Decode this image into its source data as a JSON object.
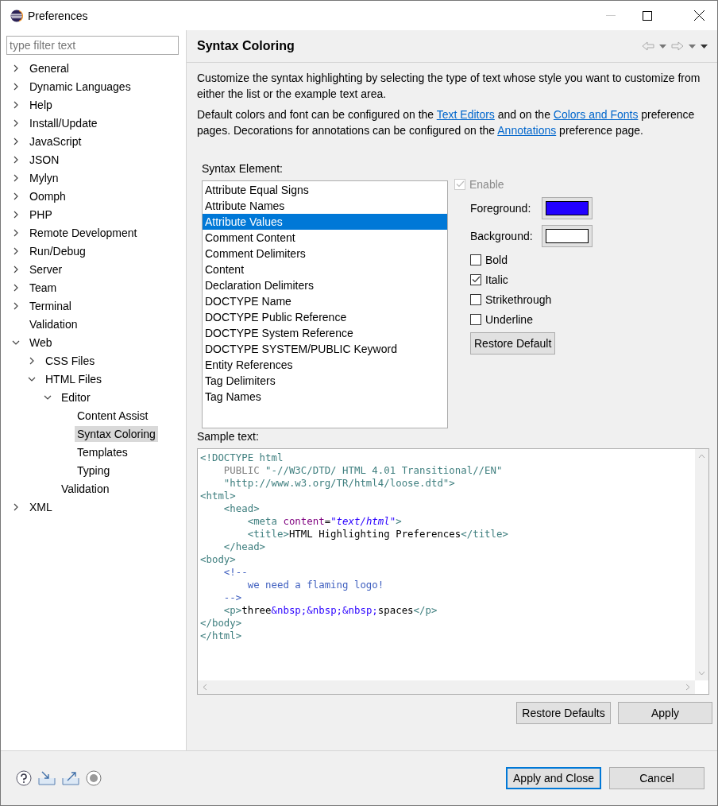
{
  "window": {
    "title": "Preferences"
  },
  "filter": {
    "placeholder": "type filter text"
  },
  "tree": [
    {
      "label": "General",
      "expanded": false,
      "selected": false
    },
    {
      "label": "Dynamic Languages",
      "expanded": false,
      "selected": false
    },
    {
      "label": "Help",
      "expanded": false,
      "selected": false
    },
    {
      "label": "Install/Update",
      "expanded": false,
      "selected": false
    },
    {
      "label": "JavaScript",
      "expanded": false,
      "selected": false
    },
    {
      "label": "JSON",
      "expanded": false,
      "selected": false
    },
    {
      "label": "Mylyn",
      "expanded": false,
      "selected": false
    },
    {
      "label": "Oomph",
      "expanded": false,
      "selected": false
    },
    {
      "label": "PHP",
      "expanded": false,
      "selected": false
    },
    {
      "label": "Remote Development",
      "expanded": false,
      "selected": false
    },
    {
      "label": "Run/Debug",
      "expanded": false,
      "selected": false
    },
    {
      "label": "Server",
      "expanded": false,
      "selected": false
    },
    {
      "label": "Team",
      "expanded": false,
      "selected": false
    },
    {
      "label": "Terminal",
      "expanded": false,
      "selected": false
    },
    {
      "label": "Validation",
      "kind": "leaf",
      "selected": false
    },
    {
      "label": "Web",
      "expanded": true,
      "selected": false,
      "children": [
        {
          "label": "CSS Files",
          "expanded": false,
          "selected": false
        },
        {
          "label": "HTML Files",
          "expanded": true,
          "selected": false,
          "children": [
            {
              "label": "Editor",
              "expanded": true,
              "selected": false,
              "children": [
                {
                  "label": "Content Assist",
                  "kind": "leaf",
                  "selected": false
                },
                {
                  "label": "Syntax Coloring",
                  "kind": "leaf",
                  "selected": true
                },
                {
                  "label": "Templates",
                  "kind": "leaf",
                  "selected": false
                },
                {
                  "label": "Typing",
                  "kind": "leaf",
                  "selected": false
                }
              ]
            },
            {
              "label": "Validation",
              "kind": "leaf",
              "selected": false
            }
          ]
        }
      ]
    },
    {
      "label": "XML",
      "expanded": false,
      "selected": false
    }
  ],
  "page": {
    "title": "Syntax Coloring",
    "description": "Customize the syntax highlighting by selecting the type of text whose style you want to customize from either the list or the example text area.",
    "note": [
      {
        "kind": "text",
        "text": "Default colors and font can be configured on the "
      },
      {
        "kind": "link",
        "text": "Text Editors"
      },
      {
        "kind": "text",
        "text": " and on the "
      },
      {
        "kind": "link",
        "text": "Colors and Fonts"
      },
      {
        "kind": "text",
        "text": " preference pages.  Decorations for annotations can be configured on the "
      },
      {
        "kind": "link",
        "text": "Annotations"
      },
      {
        "kind": "text",
        "text": " preference page."
      }
    ],
    "element_label": "Syntax Element:",
    "elements": [
      {
        "label": "Attribute Equal Signs",
        "selected": false
      },
      {
        "label": "Attribute Names",
        "selected": false
      },
      {
        "label": "Attribute Values",
        "selected": true
      },
      {
        "label": "Comment Content",
        "selected": false
      },
      {
        "label": "Comment Delimiters",
        "selected": false
      },
      {
        "label": "Content",
        "selected": false
      },
      {
        "label": "Declaration Delimiters",
        "selected": false
      },
      {
        "label": "DOCTYPE Name",
        "selected": false
      },
      {
        "label": "DOCTYPE Public Reference",
        "selected": false
      },
      {
        "label": "DOCTYPE System Reference",
        "selected": false
      },
      {
        "label": "DOCTYPE SYSTEM/PUBLIC Keyword",
        "selected": false
      },
      {
        "label": "Entity References",
        "selected": false
      },
      {
        "label": "Tag Delimiters",
        "selected": false
      },
      {
        "label": "Tag Names",
        "selected": false
      }
    ],
    "enable": {
      "label": "Enable",
      "checked": true,
      "disabled": true
    },
    "colors": [
      {
        "label": "Foreground:",
        "color": "#2200ff"
      },
      {
        "label": "Background:",
        "color": "#ffffff"
      }
    ],
    "styles": [
      {
        "label": "Bold",
        "checked": false
      },
      {
        "label": "Italic",
        "checked": true
      },
      {
        "label": "Strikethrough",
        "checked": false
      },
      {
        "label": "Underline",
        "checked": false
      }
    ],
    "restore_default": "Restore Default",
    "sample_label": "Sample text:",
    "sample": [
      [
        {
          "kind": "tag",
          "text": "<!DOCTYPE html"
        }
      ],
      [
        {
          "kind": "keyword",
          "text": "    PUBLIC "
        },
        {
          "kind": "tag",
          "text": "\"-//W3C/DTD/ HTML 4.01 Transitional//EN\""
        }
      ],
      [
        {
          "kind": "tag",
          "text": "    \"http://www.w3.org/TR/html4/loose.dtd\">"
        }
      ],
      [
        {
          "kind": "tag",
          "text": "<html>"
        }
      ],
      [
        {
          "kind": "tag",
          "text": "    <head>"
        }
      ],
      [
        {
          "kind": "tag",
          "text": "        <meta "
        },
        {
          "kind": "attr",
          "text": "content"
        },
        {
          "kind": "plain",
          "text": "="
        },
        {
          "kind": "value",
          "text": "\"text/html\""
        },
        {
          "kind": "tag",
          "text": ">"
        }
      ],
      [
        {
          "kind": "tag",
          "text": "        <title>"
        },
        {
          "kind": "plain",
          "text": "HTML Highlighting Preferences"
        },
        {
          "kind": "tag",
          "text": "</title>"
        }
      ],
      [
        {
          "kind": "tag",
          "text": "    </head>"
        }
      ],
      [
        {
          "kind": "tag",
          "text": "<body>"
        }
      ],
      [
        {
          "kind": "delim",
          "text": "    <!--"
        }
      ],
      [
        {
          "kind": "comment",
          "text": "        we need a flaming logo!"
        }
      ],
      [
        {
          "kind": "delim",
          "text": "    -->"
        }
      ],
      [
        {
          "kind": "tag",
          "text": "    <p>"
        },
        {
          "kind": "plain",
          "text": "three"
        },
        {
          "kind": "entity",
          "text": "&nbsp;&nbsp;&nbsp;"
        },
        {
          "kind": "plain",
          "text": "spaces"
        },
        {
          "kind": "tag",
          "text": "</p>"
        }
      ],
      [
        {
          "kind": "tag",
          "text": "</body>"
        }
      ],
      [
        {
          "kind": "tag",
          "text": "</html>"
        }
      ]
    ],
    "buttons": [
      "Restore Defaults",
      "Apply"
    ]
  },
  "footer": {
    "buttons": [
      {
        "label": "Apply and Close",
        "default": true
      },
      {
        "label": "Cancel",
        "default": false
      }
    ]
  }
}
